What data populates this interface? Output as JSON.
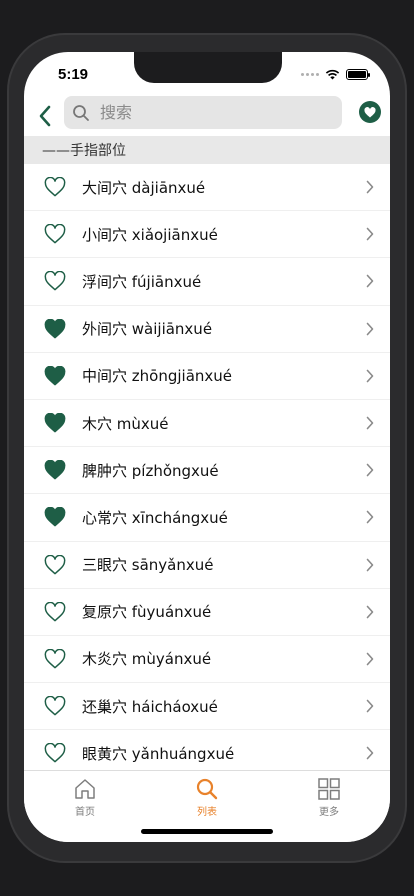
{
  "status": {
    "time": "5:19"
  },
  "search": {
    "placeholder": "搜索"
  },
  "section_title": "——手指部位",
  "colors": {
    "accent": "#1e5e46",
    "active_tab": "#e8822b"
  },
  "items": [
    {
      "label": "大间穴 dàjiānxué",
      "favorite": false
    },
    {
      "label": "小间穴 xiǎojiānxué",
      "favorite": false
    },
    {
      "label": "浮间穴 fújiānxué",
      "favorite": false
    },
    {
      "label": "外间穴 wàijiānxué",
      "favorite": true
    },
    {
      "label": "中间穴 zhōngjiānxué",
      "favorite": true
    },
    {
      "label": "木穴 mùxué",
      "favorite": true
    },
    {
      "label": "脾肿穴 pízhǒngxué",
      "favorite": true
    },
    {
      "label": "心常穴 xīnchángxué",
      "favorite": true
    },
    {
      "label": "三眼穴 sānyǎnxué",
      "favorite": false
    },
    {
      "label": "复原穴 fùyuánxué",
      "favorite": false
    },
    {
      "label": "木炎穴 mùyánxué",
      "favorite": false
    },
    {
      "label": "还巢穴 háicháoxué",
      "favorite": false
    },
    {
      "label": "眼黄穴 yǎnhuángxué",
      "favorite": false
    }
  ],
  "tabs": [
    {
      "label": "首页",
      "icon": "home-icon",
      "active": false
    },
    {
      "label": "列表",
      "icon": "search-icon",
      "active": true
    },
    {
      "label": "更多",
      "icon": "grid-icon",
      "active": false
    }
  ]
}
